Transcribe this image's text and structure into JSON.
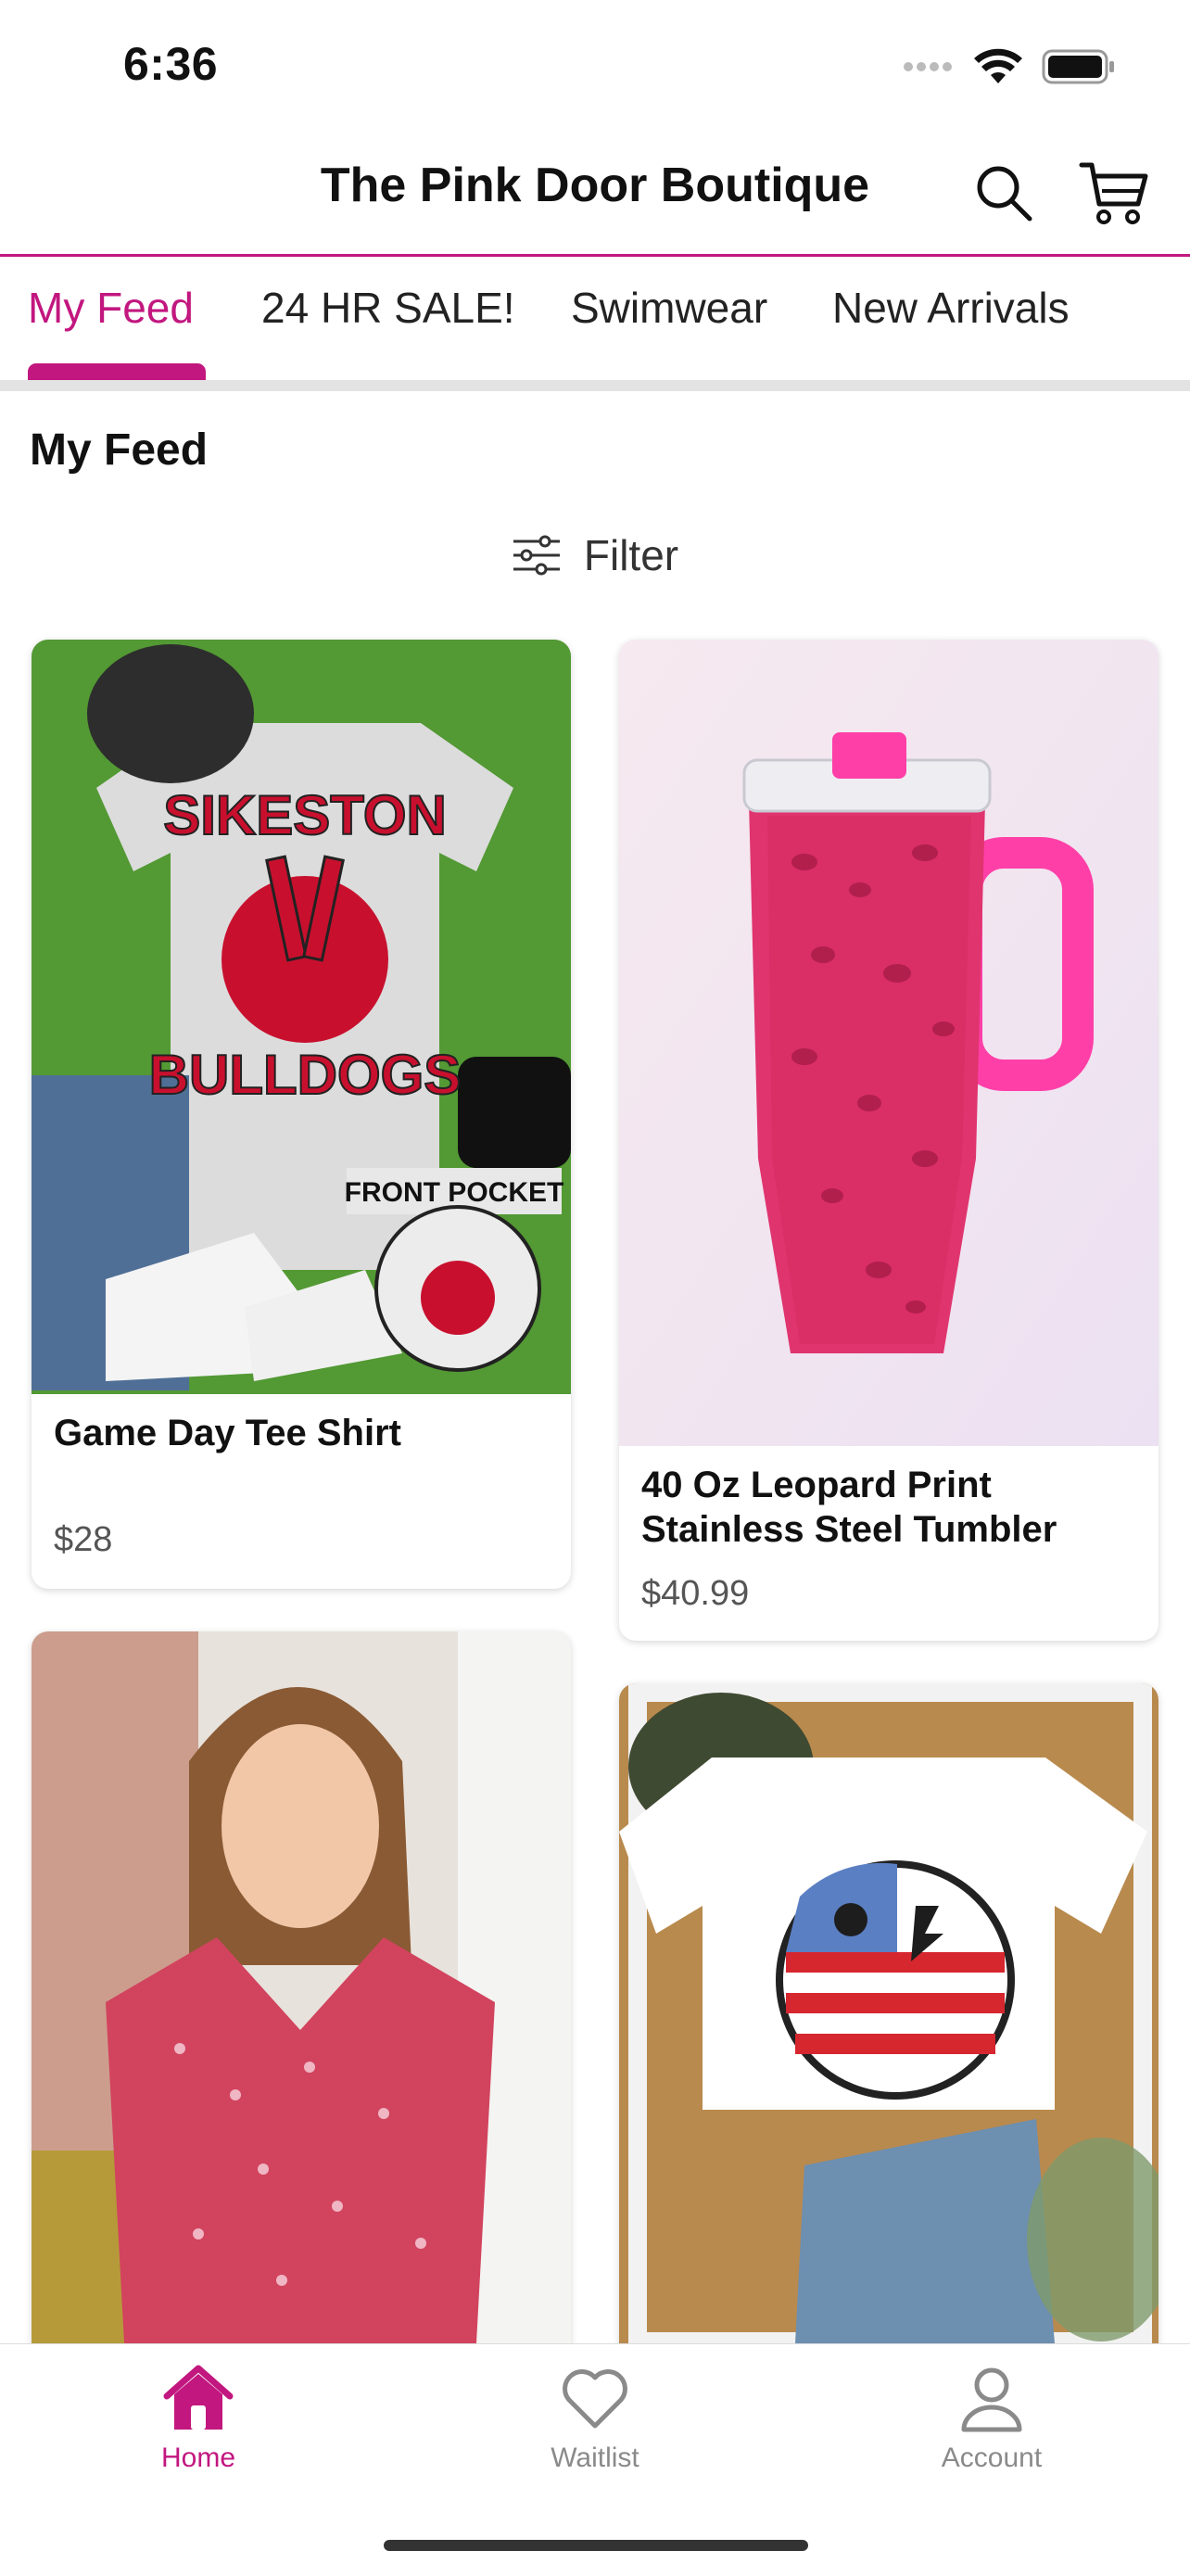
{
  "status": {
    "time": "6:36"
  },
  "header": {
    "title": "The Pink Door Boutique"
  },
  "tabs": [
    {
      "label": "My Feed"
    },
    {
      "label": "24 HR SALE!"
    },
    {
      "label": "Swimwear"
    },
    {
      "label": "New Arrivals"
    }
  ],
  "feed": {
    "title": "My Feed",
    "filter_label": "Filter"
  },
  "products": [
    {
      "name": "Game Day Tee Shirt",
      "price": "$28",
      "image": "tee-shirt-photo"
    },
    {
      "name": "40 Oz Leopard Print Stainless Steel Tumbler",
      "price": "$40.99",
      "image": "tumbler-photo"
    },
    {
      "name": "",
      "price": "",
      "image": "floral-top-photo"
    },
    {
      "name": "",
      "price": "",
      "image": "smiley-tee-photo"
    }
  ],
  "nav": [
    {
      "label": "Home",
      "icon": "home-icon"
    },
    {
      "label": "Waitlist",
      "icon": "heart-icon"
    },
    {
      "label": "Account",
      "icon": "account-icon"
    }
  ],
  "colors": {
    "accent": "#c2177f",
    "divider": "#e3e3e3"
  }
}
